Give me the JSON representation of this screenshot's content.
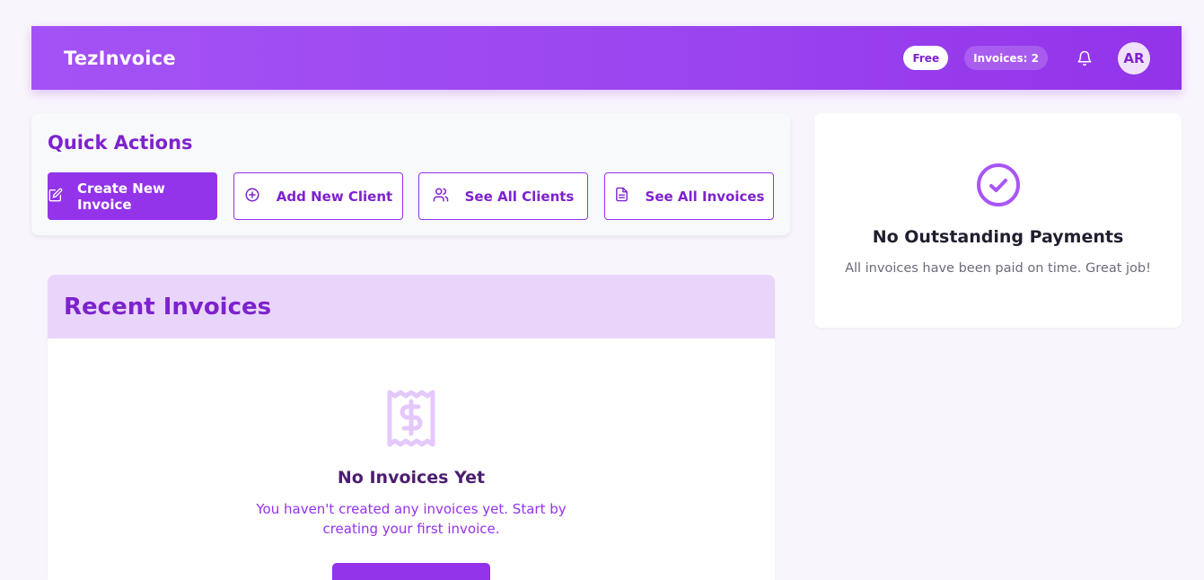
{
  "header": {
    "brand": "TezInvoice",
    "plan_badge": "Free",
    "invoice_count_badge": "Invoices: 2",
    "notification_icon": "bell-icon",
    "avatar_initials": "AR"
  },
  "quick_actions": {
    "title": "Quick Actions",
    "buttons": [
      {
        "label": "Create New Invoice",
        "icon": "edit-icon"
      },
      {
        "label": "Add New Client",
        "icon": "plus-circle-icon"
      },
      {
        "label": "See All Clients",
        "icon": "users-icon"
      },
      {
        "label": "See All Invoices",
        "icon": "file-text-icon"
      }
    ]
  },
  "payments": {
    "icon": "check-circle-icon",
    "title": "No Outstanding Payments",
    "subtitle": "All invoices have been paid on time. Great job!"
  },
  "recent_invoices": {
    "title": "Recent Invoices",
    "empty_icon": "receipt-dollar-icon",
    "empty_title": "No Invoices Yet",
    "empty_message": "You haven't created any invoices yet. Start by creating your first invoice."
  },
  "colors": {
    "primary": "#9333ea",
    "primary_dark": "#7e22ce",
    "header_light": "#e9d5fa",
    "background": "#f9f5fd"
  }
}
